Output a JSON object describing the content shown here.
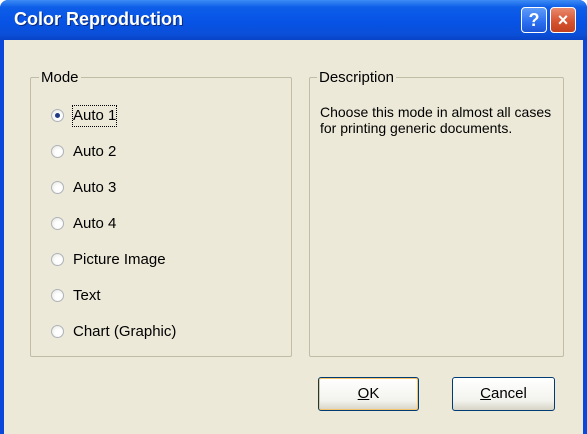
{
  "window": {
    "title": "Color Reproduction",
    "help_label": "?",
    "close_label": "×"
  },
  "mode": {
    "legend": "Mode",
    "selected": "Auto 1",
    "options": [
      {
        "label": "Auto 1",
        "checked": true
      },
      {
        "label": "Auto 2",
        "checked": false
      },
      {
        "label": "Auto 3",
        "checked": false
      },
      {
        "label": "Auto 4",
        "checked": false
      },
      {
        "label": "Picture Image",
        "checked": false
      },
      {
        "label": "Text",
        "checked": false
      },
      {
        "label": "Chart (Graphic)",
        "checked": false
      }
    ]
  },
  "description": {
    "legend": "Description",
    "text": "Choose this mode in almost all cases for printing generic documents."
  },
  "buttons": {
    "ok": {
      "mnemonic": "O",
      "rest": "K"
    },
    "cancel": {
      "mnemonic": "C",
      "rest": "ancel"
    }
  }
}
